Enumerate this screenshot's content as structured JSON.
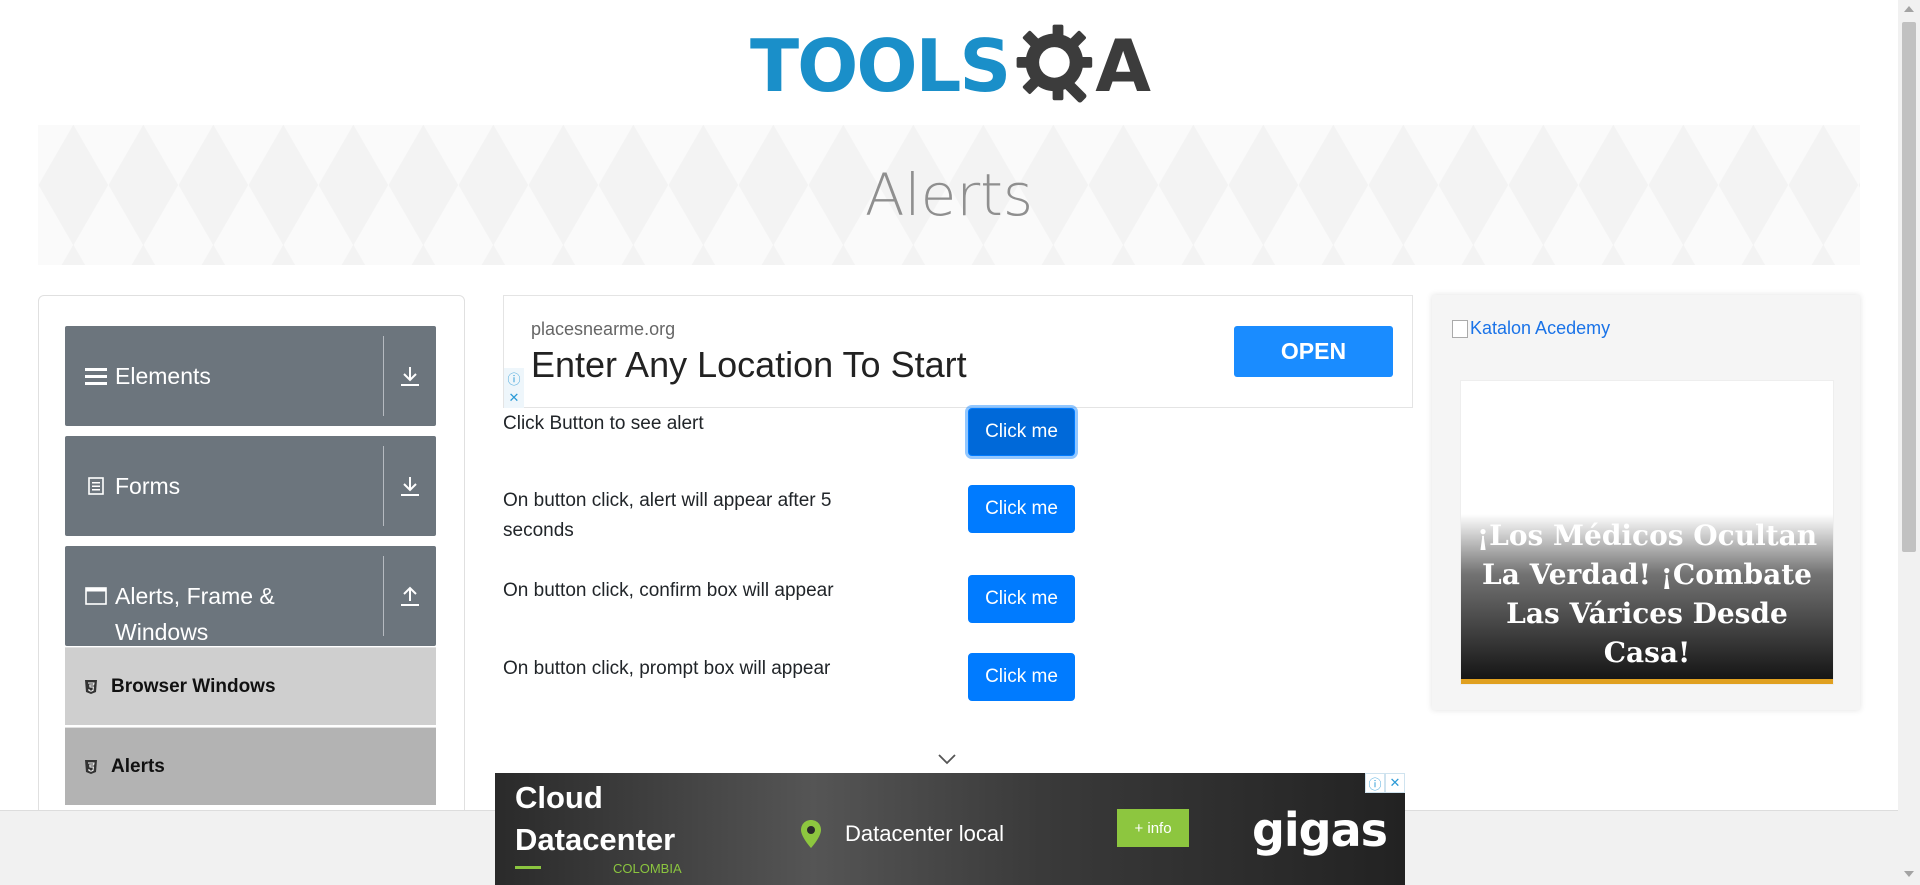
{
  "header": {
    "logo_text": "TOOLS",
    "logo_suffix": "A"
  },
  "banner": {
    "title": "Alerts"
  },
  "sidebar": {
    "groups": [
      {
        "label": "Elements",
        "icon": "hamburger-icon",
        "state": "collapsed"
      },
      {
        "label": "Forms",
        "icon": "document-icon",
        "state": "collapsed"
      },
      {
        "label": "Alerts, Frame &",
        "label_line2": "Windows",
        "icon": "window-icon",
        "state": "expanded"
      }
    ],
    "items": [
      {
        "label": "Browser Windows",
        "icon": "html5-icon",
        "active": false
      },
      {
        "label": "Alerts",
        "icon": "html5-icon",
        "active": true
      }
    ]
  },
  "ad_top": {
    "domain": "placesnearme.org",
    "headline": "Enter Any Location To Start",
    "button": "OPEN"
  },
  "alerts": [
    {
      "label": "Click Button to see alert",
      "button": "Click me"
    },
    {
      "label": "On button click, alert will appear after 5",
      "label_line2": "seconds",
      "button": "Click me"
    },
    {
      "label": "On button click, confirm box will appear",
      "button": "Click me"
    },
    {
      "label": "On button click, prompt box will appear",
      "button": "Click me"
    }
  ],
  "ad_right": {
    "link_text": "Katalon Acedemy",
    "promo_text": "¡Los Médicos Ocultan La Verdad! ¡Combate Las Várices Desde Casa!"
  },
  "ad_bottom": {
    "line1": "Cloud",
    "line2": "Datacenter",
    "country": "COLOMBIA",
    "location": "Datacenter local",
    "button": "+ info",
    "brand": "gigas"
  },
  "colors": {
    "primary_button": "#007bff",
    "sidebar_group": "#6c757d",
    "logo_blue": "#1a8fc9",
    "logo_dark": "#3c3c3c",
    "ad_open": "#1a8cff",
    "gigas_green": "#8dc63f"
  }
}
